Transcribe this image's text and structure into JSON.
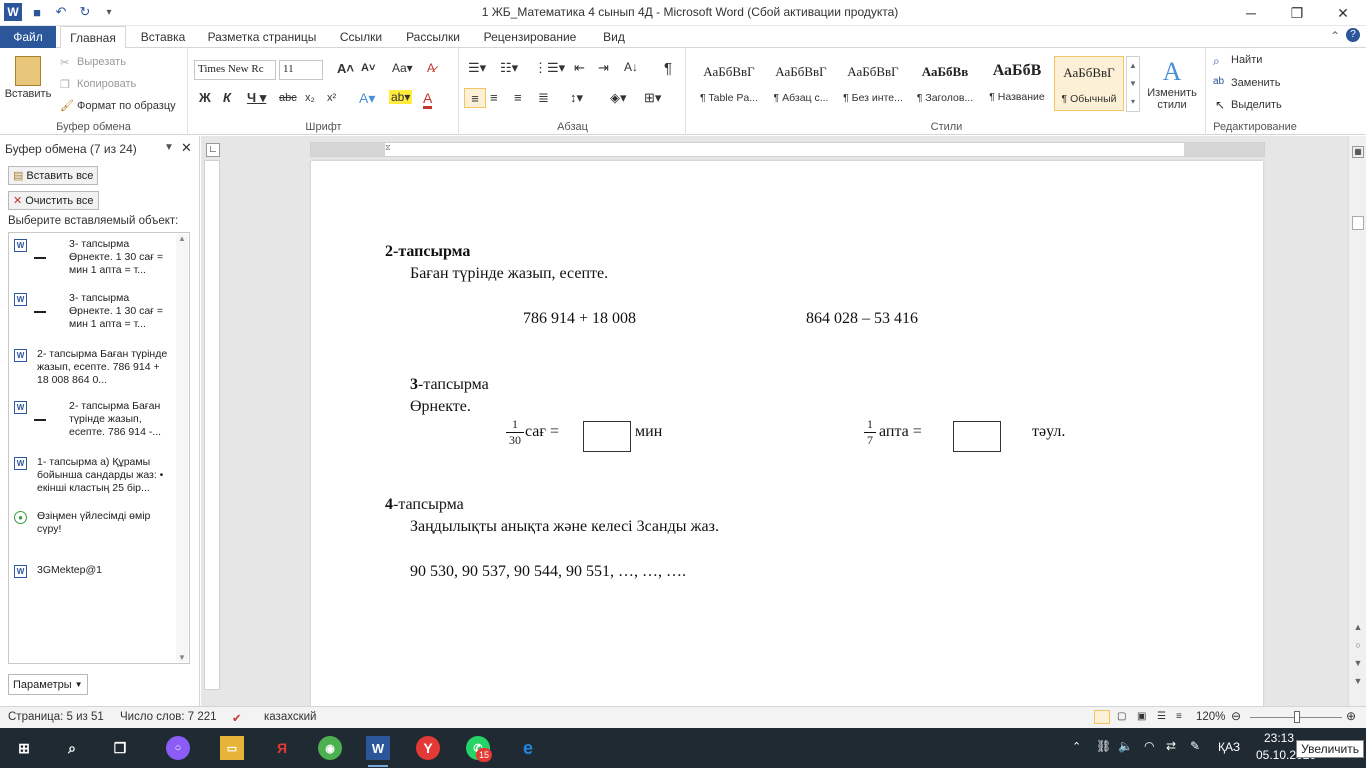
{
  "window": {
    "title": "1 ЖБ_Математика 4 сынып 4Д  -  Microsoft Word (Сбой активации продукта)"
  },
  "tabs": [
    {
      "label": "Файл"
    },
    {
      "label": "Главная"
    },
    {
      "label": "Вставка"
    },
    {
      "label": "Разметка страницы"
    },
    {
      "label": "Ссылки"
    },
    {
      "label": "Рассылки"
    },
    {
      "label": "Рецензирование"
    },
    {
      "label": "Вид"
    }
  ],
  "ribbon": {
    "clipboard": {
      "paste": "Вставить",
      "cut": "Вырезать",
      "copy": "Копировать",
      "format_painter": "Формат по образцу",
      "label": "Буфер обмена"
    },
    "font": {
      "name": "Times New Rc",
      "size": "11",
      "label": "Шрифт"
    },
    "paragraph": {
      "label": "Абзац"
    },
    "styles": {
      "items": [
        {
          "preview": "АаБбВвГ",
          "name": "¶ Table Pa..."
        },
        {
          "preview": "АаБбВвГ",
          "name": "¶ Абзац с..."
        },
        {
          "preview": "АаБбВвГ",
          "name": "¶ Без инте..."
        },
        {
          "preview": "АаБбВв",
          "name": "¶ Заголов..."
        },
        {
          "preview": "АаБбВ",
          "name": "¶ Название"
        },
        {
          "preview": "АаБбВвГ",
          "name": "¶ Обычный"
        }
      ],
      "change": "Изменить стили",
      "label": "Стили"
    },
    "editing": {
      "find": "Найти",
      "replace": "Заменить",
      "select": "Выделить",
      "label": "Редактирование"
    }
  },
  "clipboard_pane": {
    "title": "Буфер обмена (7 из 24)",
    "paste_all": "Вставить все",
    "clear_all": "Очистить все",
    "prompt": "Выберите вставляемый объект:",
    "items": [
      {
        "text": "3- тапсырма Өрнекте. 1 30 сағ = мин 1 апта = т..."
      },
      {
        "text": "3- тапсырма Өрнекте. 1 30 сағ = мин 1 апта = т..."
      },
      {
        "text": "2- тапсырма Баған түрінде жазып, есепте. 786 914 + 18 008 864 0..."
      },
      {
        "text": "2- тапсырма Баған түрінде жазып, есепте. 786 914 -..."
      },
      {
        "text": "1- тапсырма а) Құрамы бойынша сандарды жаз: • екінші кластың 25 бір..."
      },
      {
        "text": "Өзіңмен үйлесімді өмір сүру!"
      },
      {
        "text": "3GMektep@1"
      }
    ],
    "options": "Параметры"
  },
  "document": {
    "task2_num": "2",
    "task2_title": "-тапсырма",
    "task2_instr": "Баған түрінде жазып, есепте.",
    "expr1": "786 914 + 18 008",
    "expr2": "864 028 – 53 416",
    "task3_num": "3",
    "task3_title": "-тапсырма",
    "task3_instr": "Өрнекте.",
    "frac1_num": "1",
    "frac1_den": "30",
    "unit1": "сағ  =",
    "unit1_res": "мин",
    "frac2_num": "1",
    "frac2_den": "7",
    "unit2": "апта  =",
    "unit2_res": "тәул.",
    "task4_num": "4",
    "task4_title": "-тапсырма",
    "task4_instr": "Заңдылықты анықта және келесі 3санды жаз.",
    "sequence": "90 530, 90 537, 90 544, 90 551, …, …, …."
  },
  "status": {
    "page": "Страница: 5 из 51",
    "words": "Число слов: 7 221",
    "lang": "казахский",
    "zoom": "120%"
  },
  "taskbar": {
    "badge": "15",
    "lang": "ҚАЗ",
    "time": "23:13",
    "date": "05.10.2020",
    "tooltip": "Увеличить"
  }
}
